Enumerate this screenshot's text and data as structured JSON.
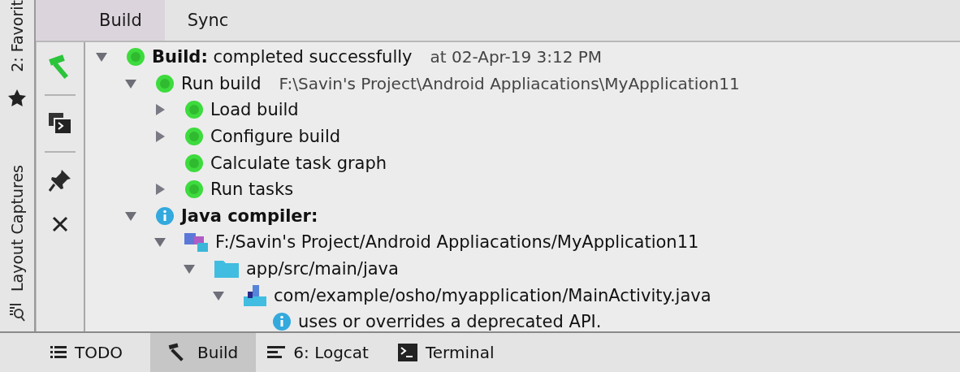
{
  "side_strip": {
    "items": [
      {
        "label": "2: Favorit",
        "kind": "favorites"
      },
      {
        "label": "Layout Captures",
        "kind": "captures"
      }
    ]
  },
  "tabs": [
    {
      "label": "Build",
      "selected": true
    },
    {
      "label": "Sync",
      "selected": false
    }
  ],
  "toolbar": {
    "items": [
      {
        "kind": "build"
      },
      {
        "kind": "console"
      },
      {
        "kind": "pin"
      },
      {
        "kind": "close"
      }
    ]
  },
  "tree": [
    {
      "kind": "ok",
      "label": "**Build:** completed successfully",
      "detail": "at 02-Apr-19 3:12 PM",
      "expanded": true,
      "children": [
        {
          "kind": "ok",
          "label": "Run build",
          "detail": "F:\\Savin's Project\\Android Appliacations\\MyApplication11",
          "expanded": true,
          "children": [
            {
              "kind": "ok",
              "label": "Load build",
              "expanded": false
            },
            {
              "kind": "ok",
              "label": "Configure build",
              "expanded": false
            },
            {
              "kind": "ok",
              "label": "Calculate task graph"
            },
            {
              "kind": "ok",
              "label": "Run tasks",
              "expanded": false
            }
          ]
        },
        {
          "kind": "info",
          "label": "Java compiler:",
          "bold": true,
          "expanded": true,
          "children": [
            {
              "kind": "project",
              "label": "F:/Savin's Project/Android Appliacations/MyApplication11",
              "expanded": true,
              "children": [
                {
                  "kind": "folder",
                  "label": "app/src/main/java",
                  "expanded": true,
                  "children": [
                    {
                      "kind": "java",
                      "label": "com/example/osho/myapplication/MainActivity.java",
                      "expanded": true,
                      "children": [
                        {
                          "kind": "info",
                          "label": "uses or overrides a deprecated API."
                        }
                      ]
                    }
                  ]
                }
              ]
            }
          ]
        }
      ]
    }
  ],
  "bottom_tabs": [
    {
      "label": "TODO",
      "kind": "list",
      "selected": false
    },
    {
      "label": "Build",
      "kind": "hammer",
      "selected": true
    },
    {
      "label": "6: Logcat",
      "kind": "logcat",
      "selected": false
    },
    {
      "label": "Terminal",
      "kind": "terminal",
      "selected": false
    }
  ]
}
